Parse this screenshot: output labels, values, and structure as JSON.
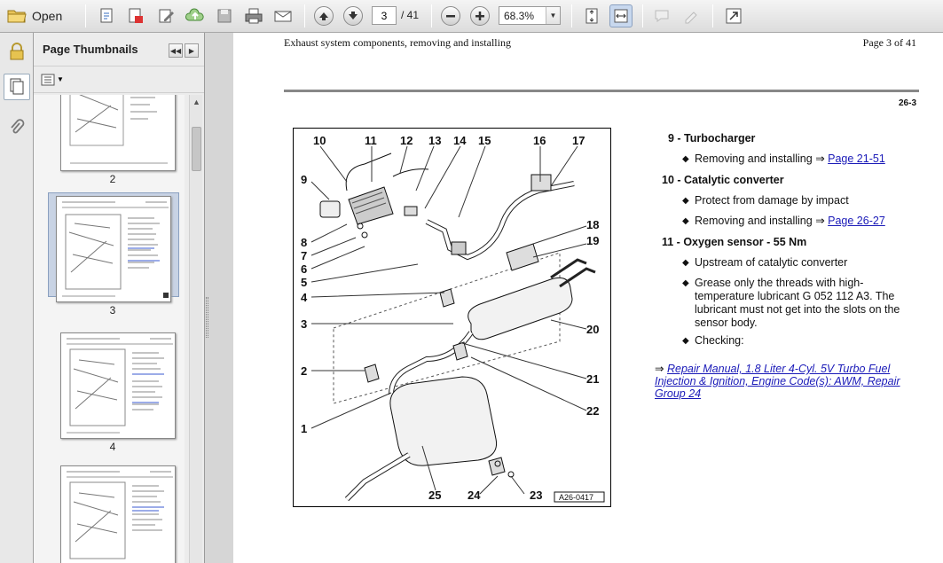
{
  "toolbar": {
    "open_label": "Open",
    "page_current": "3",
    "page_total": "/ 41",
    "zoom": "68.3%"
  },
  "panel": {
    "title": "Page Thumbnails",
    "thumbnails": [
      {
        "label": "2"
      },
      {
        "label": "3"
      },
      {
        "label": "4"
      },
      {
        "label": ""
      }
    ]
  },
  "document": {
    "header_title": "Exhaust system components, removing and installing",
    "header_page": "Page 3 of 41",
    "section_number": "26-3",
    "figure_id": "A26-0417",
    "callouts": [
      "10",
      "11",
      "12",
      "13",
      "14",
      "15",
      "16",
      "17",
      "9",
      "18",
      "19",
      "8",
      "7",
      "6",
      "5",
      "4",
      "3",
      "20",
      "2",
      "21",
      "22",
      "1",
      "25",
      "24",
      "23"
    ],
    "items": [
      {
        "head": "9 - Turbocharger",
        "bullets": [
          {
            "text": "Removing and installing ⇒ ",
            "link": "Page 21-51"
          }
        ]
      },
      {
        "head": "10 - Catalytic converter",
        "bullets": [
          {
            "text": "Protect from damage by impact",
            "link": ""
          },
          {
            "text": "Removing and installing ⇒ ",
            "link": "Page 26-27"
          }
        ]
      },
      {
        "head": "11 - Oxygen sensor - 55 Nm",
        "bullets": [
          {
            "text": "Upstream of catalytic converter",
            "link": ""
          },
          {
            "text": "Grease only the threads with high-temperature lubricant G 052 112 A3. The lubricant must not get into the slots on the sensor body.",
            "link": ""
          },
          {
            "text": "Checking:",
            "link": ""
          }
        ]
      }
    ],
    "reference_arrow": "⇒",
    "reference_link": "Repair Manual, 1.8 Liter 4-Cyl. 5V Turbo Fuel Injection & Ignition, Engine Code(s): AWM, Repair Group 24"
  }
}
